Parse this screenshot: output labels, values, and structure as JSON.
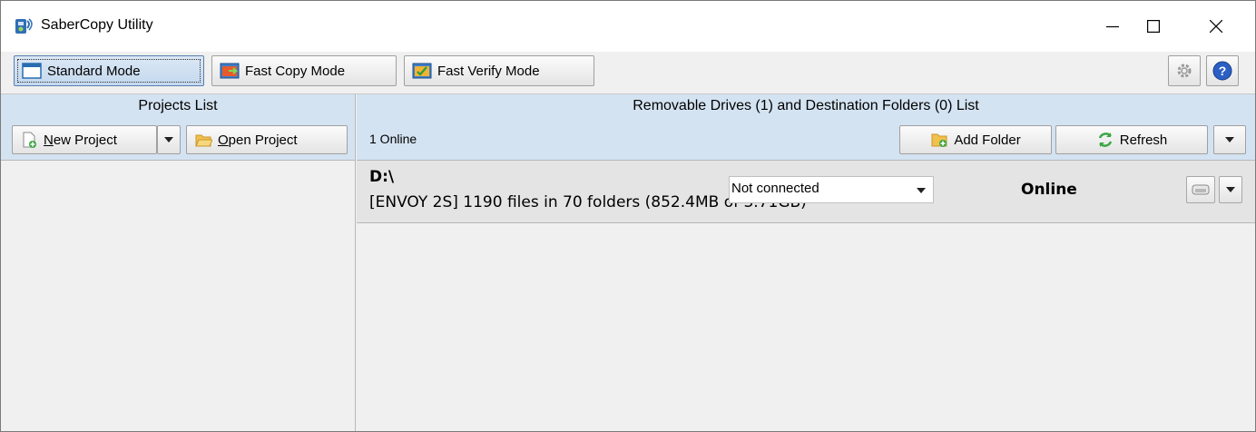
{
  "window": {
    "title": "SaberCopy Utility",
    "controls": {
      "minimize": "minimize",
      "maximize": "maximize",
      "close": "close"
    }
  },
  "toolbar": {
    "modes": [
      {
        "label": "Standard Mode",
        "icon": "window-icon",
        "active": true
      },
      {
        "label": "Fast Copy Mode",
        "icon": "fast-copy-icon",
        "active": false
      },
      {
        "label": "Fast Verify Mode",
        "icon": "fast-verify-icon",
        "active": false
      }
    ],
    "settings_icon": "gear-icon",
    "help_icon": "help-icon"
  },
  "projects": {
    "header": "Projects List",
    "new_project_label": "New Project",
    "new_project_mnemonic": "N",
    "new_project_rest": "ew Project",
    "open_project_mnemonic": "O",
    "open_project_rest": "pen Project",
    "open_project_label": "Open Project"
  },
  "drives": {
    "header": "Removable Drives (1) and Destination Folders (0) List",
    "online_count": "1 Online",
    "add_folder_label": "Add Folder",
    "refresh_label": "Refresh",
    "items": [
      {
        "letter": "D:\\",
        "info": "[ENVOY 2S] 1190 files in 70 folders (852.4MB of 3.71GB)",
        "connection": "Not connected",
        "status": "Online"
      }
    ]
  },
  "colors": {
    "panel_header": "#d4e3f2",
    "window_bg": "#f0f0f0",
    "drive_row": "#e4e4e4",
    "active_mode": "#c4d8ee"
  }
}
